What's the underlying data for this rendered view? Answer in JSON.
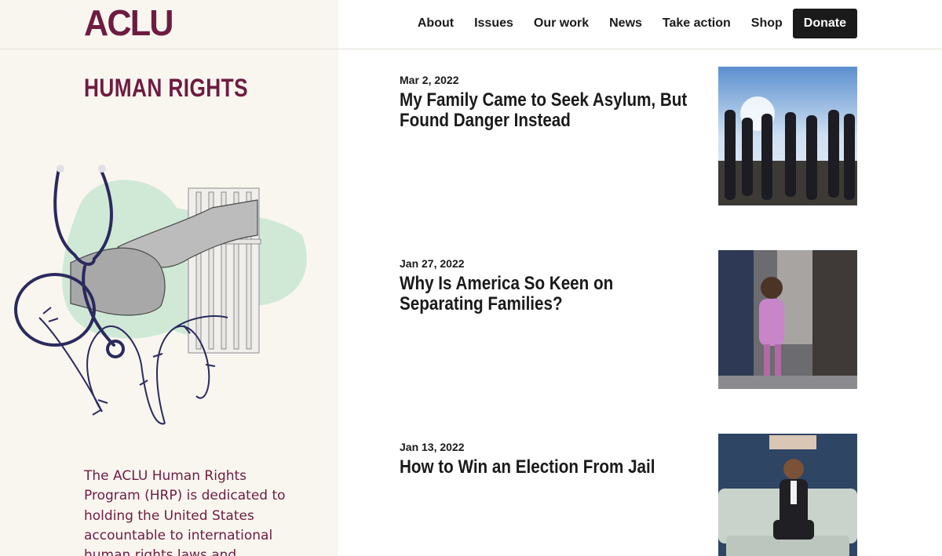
{
  "logo": {
    "text": "ACLU"
  },
  "nav": {
    "items": [
      "About",
      "Issues",
      "Our work",
      "News",
      "Take action",
      "Shop"
    ],
    "donate_label": "Donate"
  },
  "page": {
    "title": "HUMAN RIGHTS",
    "intro": "The ACLU Human Rights Program (HRP) is dedicated to holding the United States accountable to international human rights laws and"
  },
  "articles": [
    {
      "date": "Mar 2, 2022",
      "title": "My Family Came to Seek Asylum, But Found Danger Instead"
    },
    {
      "date": "Jan 27, 2022",
      "title": "Why Is America So Keen on Separating Families?"
    },
    {
      "date": "Jan 13, 2022",
      "title": "How to Win an Election From Jail"
    }
  ],
  "colors": {
    "brand": "#6e1c40",
    "left_panel": "#f9f6f0",
    "accent_green": "#cfe9d6"
  }
}
